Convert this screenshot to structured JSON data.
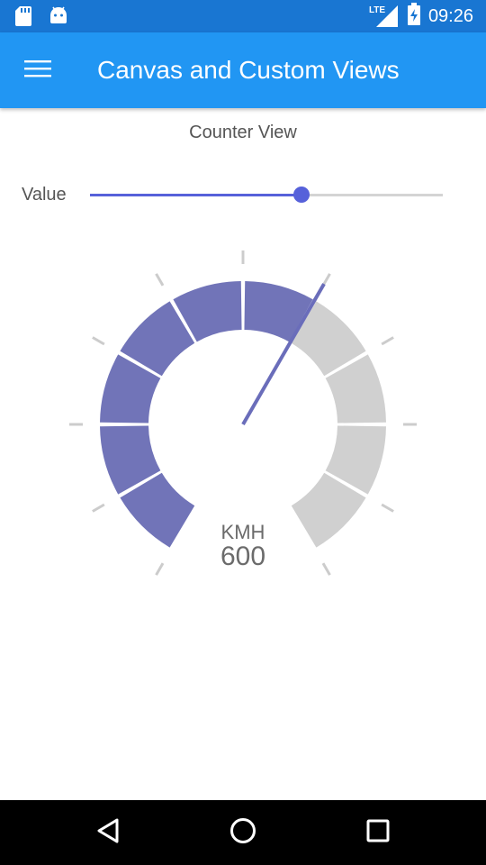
{
  "status_bar": {
    "time": "09:26",
    "network": "LTE",
    "icons": [
      "sd-card-icon",
      "android-icon",
      "lte-signal-icon",
      "battery-charging-icon"
    ]
  },
  "app_bar": {
    "title": "Canvas and Custom Views",
    "menu_icon": "menu-icon",
    "color": "#2196F3",
    "status_color": "#1976D2"
  },
  "counter": {
    "title": "Counter View",
    "value_label": "Value",
    "slider_fraction": 0.6
  },
  "gauge": {
    "unit": "KMH",
    "value": "600",
    "min": 0,
    "max": 1000,
    "current": 600,
    "segments": 10,
    "active_color": "#7174B8",
    "inactive_color": "#D0D0D0",
    "tick_color": "#CCCCCC"
  },
  "nav_bar": {
    "buttons": [
      "back-icon",
      "home-icon",
      "recents-icon"
    ]
  }
}
